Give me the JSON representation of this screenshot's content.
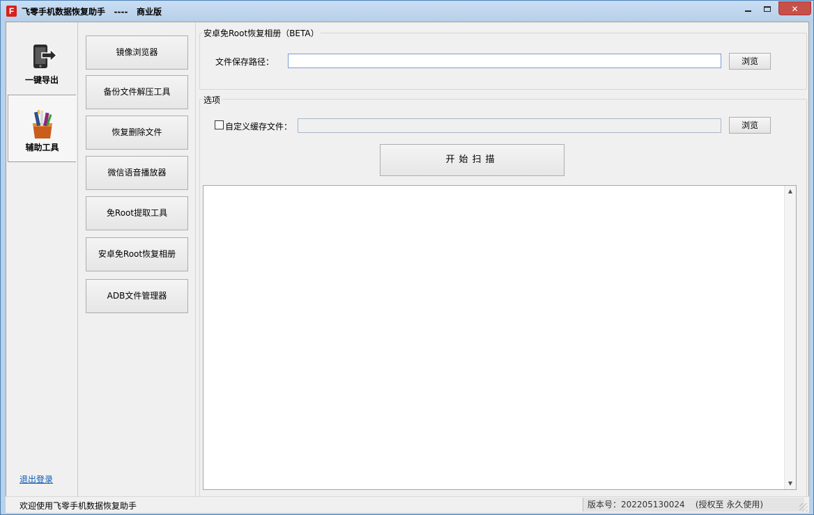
{
  "window": {
    "title": "飞零手机数据恢复助手   ----   商业版",
    "minimize_label": "",
    "maximize_label": "",
    "close_label": "✕"
  },
  "nav": {
    "items": [
      {
        "label": "一键导出",
        "icon": "phone-export-icon"
      },
      {
        "label": "辅助工具",
        "icon": "toolbox-icon"
      }
    ],
    "logout": "退出登录"
  },
  "tools": [
    "镜像浏览器",
    "备份文件解压工具",
    "恢复删除文件",
    "微信语音播放器",
    "免Root提取工具",
    "安卓免Root恢复相册",
    "ADB文件管理器"
  ],
  "main": {
    "group1_title": "安卓免Root恢复相册（BETA）",
    "save_path_label": "文件保存路径：",
    "save_path_value": "",
    "browse1": "浏览",
    "group2_title": "选项",
    "custom_cache_label": "自定义缓存文件：",
    "custom_cache_checked": false,
    "custom_cache_value": "",
    "browse2": "浏览",
    "scan_button": "开始扫描",
    "log_text": ""
  },
  "statusbar": {
    "welcome": "欢迎使用飞零手机数据恢复助手",
    "version": "版本号：202205130024    (授权至 永久使用)"
  }
}
